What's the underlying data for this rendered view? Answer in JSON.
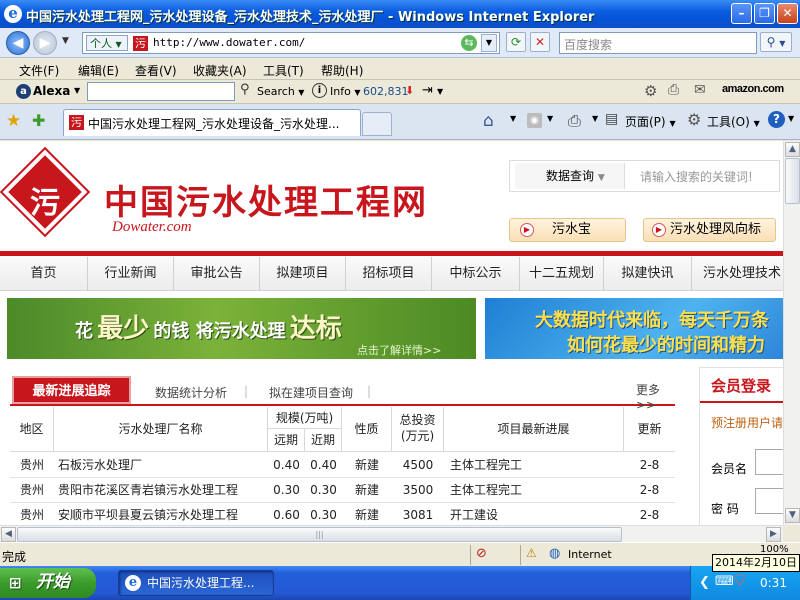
{
  "window": {
    "title": "中国污水处理工程网_污水处理设备_污水处理技术_污水处理厂 - Windows Internet Explorer"
  },
  "address": {
    "profile": "个人",
    "url": "http://www.dowater.com/",
    "search_placeholder": "百度搜索"
  },
  "menu": [
    "文件(F)",
    "编辑(E)",
    "查看(V)",
    "收藏夹(A)",
    "工具(T)",
    "帮助(H)"
  ],
  "alexa": {
    "brand": "Alexa",
    "search_label": "Search",
    "info_label": "Info",
    "rank": "602,831",
    "amazon": "amazon.com"
  },
  "tab": {
    "title": "中国污水处理工程网_污水处理设备_污水处理..."
  },
  "command_bar": {
    "page_label": "页面(P)",
    "tools_label": "工具(O)"
  },
  "site": {
    "logo_char": "污",
    "name": "中国污水处理工程网",
    "domain_logo": "Dowater.com",
    "search_type": "数据查询",
    "search_placeholder": "请输入搜索的关键词!",
    "btn_treasure": "污水宝",
    "btn_vane": "污水处理风向标",
    "nav": [
      "首页",
      "行业新闻",
      "审批公告",
      "拟建项目",
      "招标项目",
      "中标公示",
      "十二五规划",
      "拟建快讯",
      "污水处理技术"
    ],
    "banner1": {
      "pre": "花",
      "big1": "最少",
      "mid": "的钱 将污水处理",
      "big2": "达标",
      "link": "点击了解详情>>"
    },
    "banner2": {
      "line1": "大数据时代来临，每天千万条",
      "line2": "如何花最少的时间和精力"
    },
    "progress": {
      "tab_active": "最新进展追踪",
      "tab2": "数据统计分析",
      "tab3": "拟在建项目查询",
      "more": "更多>>",
      "headers": {
        "region": "地区",
        "name": "污水处理厂名称",
        "scale": "规模(万吨)",
        "near": "近期",
        "far": "远期",
        "nature": "性质",
        "invest_l1": "总投资",
        "invest_l2": "(万元)",
        "progress": "项目最新进展",
        "update": "更新"
      },
      "rows": [
        {
          "region": "贵州",
          "name": "石板污水处理厂",
          "far": "0.40",
          "near": "0.40",
          "nature": "新建",
          "invest": "4500",
          "progress": "主体工程完工",
          "update": "2-8"
        },
        {
          "region": "贵州",
          "name": "贵阳市花溪区青岩镇污水处理工程",
          "far": "0.30",
          "near": "0.30",
          "nature": "新建",
          "invest": "3500",
          "progress": "主体工程完工",
          "update": "2-8"
        },
        {
          "region": "贵州",
          "name": "安顺市平坝县夏云镇污水处理工程",
          "far": "0.60",
          "near": "0.30",
          "nature": "新建",
          "invest": "3081",
          "progress": "开工建设",
          "update": "2-8"
        }
      ]
    },
    "member": {
      "title": "会员登录",
      "register": "预注册用户请",
      "username_label": "会员名",
      "password_label": "密 码"
    }
  },
  "status": {
    "text": "完成",
    "zone": "Internet",
    "zoom": "100%",
    "date_tip": "2014年2月10日"
  },
  "taskbar": {
    "start": "开始",
    "task": "中国污水处理工程...",
    "clock": "0:31"
  }
}
